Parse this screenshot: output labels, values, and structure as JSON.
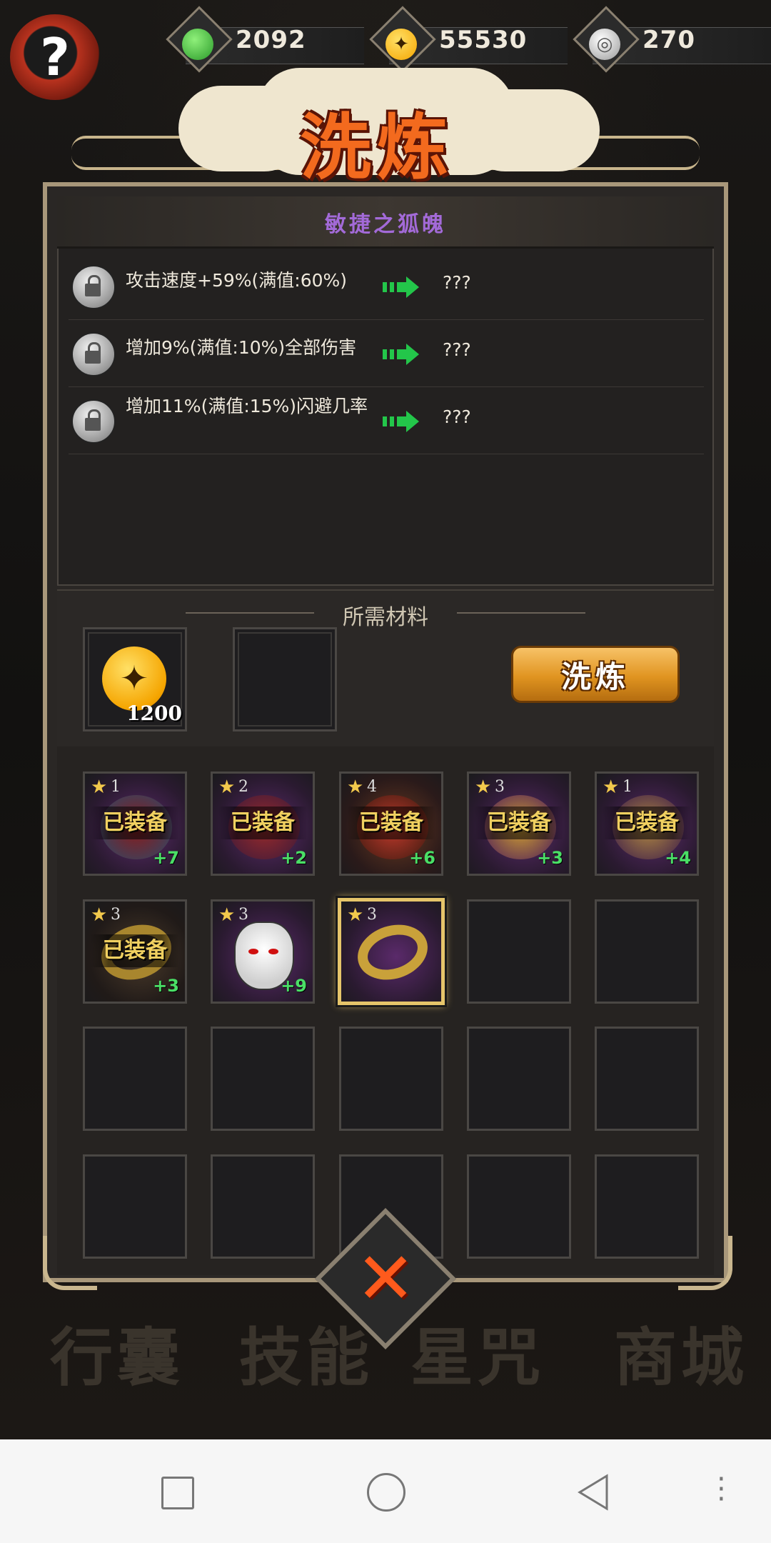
{
  "currencies": [
    {
      "name": "jade-icon",
      "value": "2092",
      "color": "#3fc24a"
    },
    {
      "name": "gold-coin-icon",
      "value": "55530",
      "color": "#f5a500"
    },
    {
      "name": "swirl-token-icon",
      "value": "270",
      "color": "#cfcfcf"
    }
  ],
  "title": "洗炼",
  "item_name": "敏捷之狐魄",
  "attributes": [
    {
      "text": "攻击速度+59%(满值:60%)",
      "result": "???"
    },
    {
      "text": "增加9%(满值:10%)全部伤害",
      "result": "???"
    },
    {
      "text": "增加11%(满值:15%)闪避几率",
      "result": "???"
    }
  ],
  "materials": {
    "title": "所需材料",
    "slot1_count": "1200",
    "button_label": "洗炼"
  },
  "equipment": [
    {
      "stars": "1",
      "label": "已装备",
      "plus": "+7"
    },
    {
      "stars": "2",
      "label": "已装备",
      "plus": "+2"
    },
    {
      "stars": "4",
      "label": "已装备",
      "plus": "+6"
    },
    {
      "stars": "3",
      "label": "已装备",
      "plus": "+3"
    },
    {
      "stars": "1",
      "label": "已装备",
      "plus": "+4"
    },
    {
      "stars": "3",
      "label": "已装备",
      "plus": "+3"
    },
    {
      "stars": "3",
      "label": "",
      "plus": "+9"
    },
    {
      "stars": "3",
      "label": "",
      "plus": ""
    }
  ],
  "bottom_tabs": [
    "行囊",
    "技能",
    "星咒",
    "商城"
  ],
  "help_icon": "?"
}
